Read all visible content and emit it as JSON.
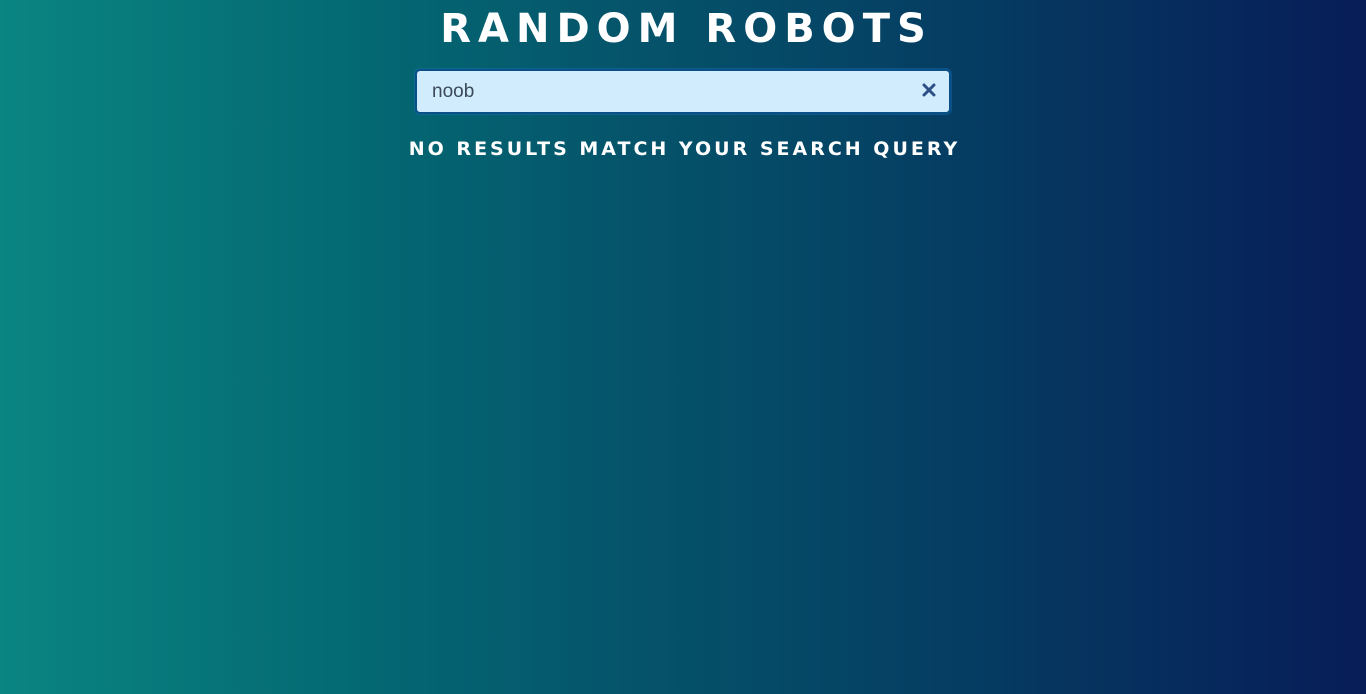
{
  "header": {
    "title": "RANDOM ROBOTS"
  },
  "search": {
    "value": "noob",
    "clear_icon": "close-icon",
    "clear_icon_color": "#2d4f86"
  },
  "results": {
    "empty_message": "NO RESULTS MATCH YOUR SEARCH QUERY"
  },
  "theme": {
    "gradient_start": "#0a8582",
    "gradient_end": "#071d58",
    "search_background": "#d1ecfc",
    "search_border": "#0a4f86"
  }
}
